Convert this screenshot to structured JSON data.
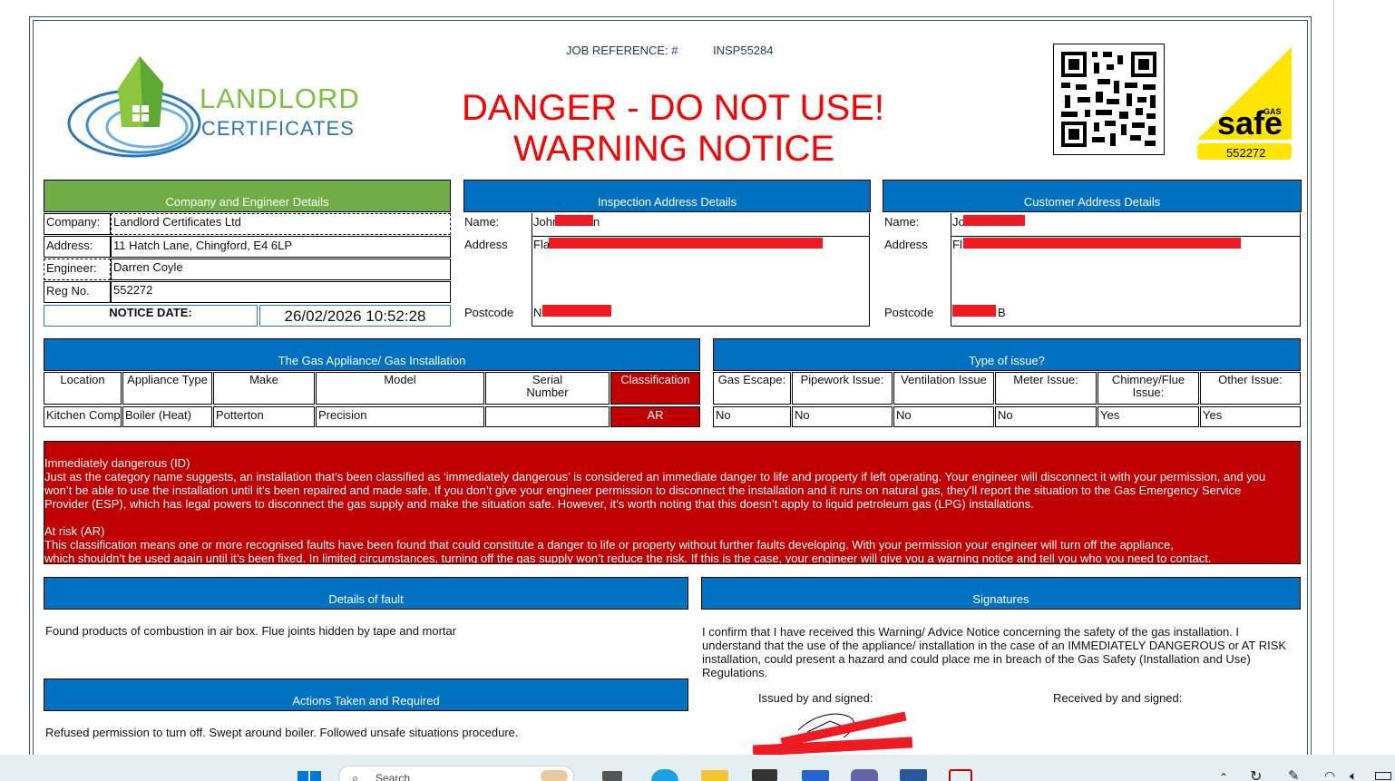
{
  "header": {
    "job_ref_label": "JOB REFERENCE: #",
    "job_ref_value": "INSP55284",
    "logo_line1": "LANDLORD",
    "logo_line2": "CERTIFICATES",
    "danger_line1": "DANGER - DO NOT USE!",
    "danger_line2": "WARNING NOTICE",
    "gas_safe_small": "GAS",
    "gas_safe_word": "safe",
    "gas_safe_number": "552272"
  },
  "company": {
    "header": "Company and Engineer Details",
    "company_label": "Company:",
    "company_value": "Landlord Certificates Ltd",
    "address_label": "Address:",
    "address_value": "11 Hatch Lane, Chingford, E4 6LP",
    "engineer_label": "Engineer:",
    "engineer_value": "Darren Coyle",
    "reg_label": "Reg No.",
    "reg_value": "552272",
    "notice_date_label": "NOTICE DATE:",
    "notice_date_value": "26/02/2026 10:52:28"
  },
  "inspection": {
    "header": "Inspection Address Details",
    "name_label": "Name:",
    "name_value": "John",
    "name_tail": "n",
    "address_label": "Address",
    "address_value": "Fla",
    "postcode_label": "Postcode",
    "postcode_value": "N"
  },
  "customer": {
    "header": "Customer Address Details",
    "name_label": "Name:",
    "name_value": "Jo",
    "address_label": "Address",
    "address_value": "Fl",
    "postcode_label": "Postcode",
    "postcode_value": "B"
  },
  "appliance": {
    "header": "The Gas Appliance/ Gas Installation",
    "columns": [
      "Location",
      "Appliance Type",
      "Make",
      "Model",
      "Serial Number",
      "Classification"
    ],
    "row": [
      "Kitchen Comp",
      "Boiler (Heat)",
      "Potterton",
      "Precision",
      "",
      "AR"
    ]
  },
  "issue": {
    "header": "Type of issue?",
    "columns": [
      "Gas Escape:",
      "Pipework Issue:",
      "Ventilation Issue",
      "Meter Issue:",
      "Chimney/Flue Issue:",
      "Other Issue:"
    ],
    "row": [
      "No",
      "No",
      "No",
      "No",
      "Yes",
      "Yes"
    ]
  },
  "classification_info": {
    "id_title": "Immediately dangerous (ID)",
    "id_line1": "Just as the category name suggests, an installation that’s been classified as ‘immediately dangerous’ is considered an immediate danger to life and property if left operating. Your engineer will disconnect it with your permission, and you",
    "id_line2": "won’t be able to use the installation until it’s been repaired and made safe. If you don’t give your engineer permission to disconnect the installation and it runs on natural gas, they’ll report the situation to the Gas Emergency Service",
    "id_line3": "Provider (ESP), which has legal powers to disconnect the gas supply and make the situation safe. However, it’s worth noting that this doesn’t apply to liquid petroleum gas (LPG) installations.",
    "ar_title": "At risk (AR)",
    "ar_line1": "This classification means one or more recognised faults have been found that could constitute a danger to life or property without further faults developing. With your permission your engineer will turn off the appliance,",
    "ar_line2": "which shouldn’t be used again until it’s been fixed. In limited circumstances, turning off the gas supply won’t reduce the risk. If this is the case, your engineer will give you a warning notice and tell you who you need to contact."
  },
  "fault": {
    "header": "Details of fault",
    "text": "Found products of combustion in air box. Flue joints hidden by tape and mortar"
  },
  "actions": {
    "header": "Actions Taken and Required",
    "text": "Refused permission to turn off. Swept around boiler. Followed unsafe situations procedure."
  },
  "signatures": {
    "header": "Signatures",
    "line1": "I confirm that I have received this Warning/ Advice Notice concerning the safety of the gas installation. I",
    "line2": "understand that the use of the appliance/ installation in the case of an IMMEDIATELY DANGEROUS or AT RISK",
    "line3": "installation, could present a hazard and could place me in breach of the Gas Safety (Installation and Use)",
    "line4": "Regulations.",
    "issued_label": "Issued by and signed:",
    "received_label": "Received by and signed:"
  },
  "taskbar": {
    "search_text": "Search"
  },
  "colors": {
    "section_blue": "#0070c0",
    "section_green": "#70ad47",
    "danger_red": "#ff0000",
    "class_red": "#c00000",
    "gas_safe_yellow": "#ffe500"
  }
}
